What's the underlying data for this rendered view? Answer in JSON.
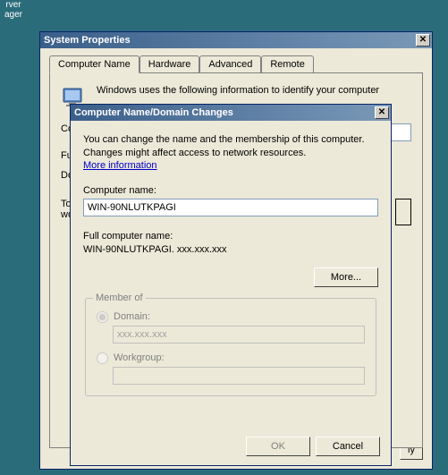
{
  "desktop": {
    "icon_label": "rver\nager"
  },
  "sysprops": {
    "title": "System Properties",
    "tabs": [
      "Computer Name",
      "Hardware",
      "Advanced",
      "Remote"
    ],
    "info": "Windows uses the following information to identify your computer",
    "rows": {
      "co": "Co",
      "full": "Full",
      "do": "Do",
      "to": "To",
      "wo": "wo"
    },
    "apply": "ly"
  },
  "dlg": {
    "title": "Computer Name/Domain Changes",
    "desc": "You can change the name and the membership of this computer. Changes might affect access to network resources.",
    "more_info": "More information",
    "computer_name_label": "Computer name:",
    "computer_name_value": "WIN-90NLUTKPAGI",
    "full_label": "Full computer name:",
    "full_value": "WIN-90NLUTKPAGI. xxx.xxx.xxx",
    "more_btn": "More...",
    "member_of": "Member of",
    "domain_label": "Domain:",
    "domain_value": "xxx.xxx.xxx",
    "workgroup_label": "Workgroup:",
    "workgroup_value": "",
    "ok": "OK",
    "cancel": "Cancel"
  }
}
